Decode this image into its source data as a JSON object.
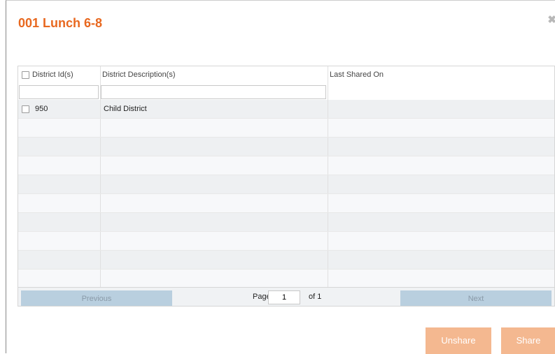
{
  "dialog": {
    "title": "001 Lunch 6-8",
    "close_glyph": "✖"
  },
  "grid": {
    "columns": [
      "District Id(s)",
      "District Description(s)",
      "Last Shared On"
    ],
    "rows": [
      {
        "id": "950",
        "description": "Child District",
        "last_shared": ""
      }
    ]
  },
  "pager": {
    "previous_label": "Previous",
    "next_label": "Next",
    "page_label": "Page",
    "page_value": "1",
    "of_label": "of 1"
  },
  "actions": {
    "unshare_label": "Unshare",
    "share_label": "Share"
  },
  "colors": {
    "title": "#e8681f",
    "action_button": "#f4b890",
    "pager_button": "#b9cfdf"
  }
}
